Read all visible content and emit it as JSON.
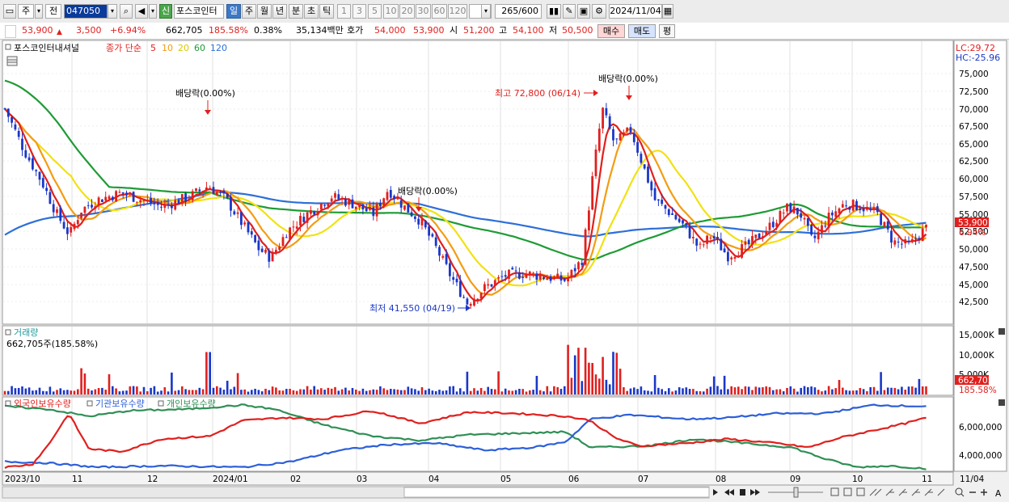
{
  "toolbar": {
    "period": "주",
    "compare": "전",
    "code": "047050",
    "credit_tag": "신",
    "stock_name": "포스코인터",
    "intervals": [
      "일",
      "주",
      "월",
      "년",
      "분",
      "초",
      "틱"
    ],
    "active_interval": "일",
    "minute_options": [
      "1",
      "3",
      "5",
      "10",
      "20",
      "30",
      "60",
      "120"
    ],
    "count": "265",
    "count_max": "/600",
    "date": "2024/11/04"
  },
  "quote": {
    "price": "53,900",
    "change": "3,500",
    "change_pct": "+6.94%",
    "volume": "662,705",
    "volume_ratio": "185.58%",
    "turnover": "0.38%",
    "amount": "35,134백만",
    "bid_label": "호가",
    "ask": "54,000",
    "bid": "53,900",
    "open_label": "시",
    "open": "51,200",
    "high_label": "고",
    "high": "54,100",
    "low_label": "저",
    "low": "50,500",
    "buy_label": "매수",
    "sell_label": "매도",
    "avg_label": "평"
  },
  "legend": {
    "name": "포스코인터내셔널",
    "series": "종가 단순",
    "ma": [
      {
        "label": "5",
        "color": "#e0201e"
      },
      {
        "label": "10",
        "color": "#f39c12"
      },
      {
        "label": "20",
        "color": "#f1e211"
      },
      {
        "label": "60",
        "color": "#1e9b35"
      },
      {
        "label": "120",
        "color": "#2d6fd8"
      }
    ]
  },
  "price_axis": {
    "lc": "LC:29.72",
    "hc": "HC:-25.96",
    "ticks": [
      "75,000",
      "72,500",
      "70,000",
      "67,500",
      "65,000",
      "62,500",
      "60,000",
      "57,500",
      "55,000",
      "52,500",
      "50,000",
      "47,500",
      "45,000",
      "42,500"
    ],
    "current": "53,900",
    "current_pct": "6.94%"
  },
  "annotations": {
    "dividend1": "배당락(0.00%)",
    "dividend2": "배당락(0.00%)",
    "dividend3": "배당락(0.00%)",
    "high": "최고 72,800 (06/14)",
    "low": "최저 41,550 (04/19)"
  },
  "volume_panel": {
    "title": "거래량",
    "value": "662,705주(185.58%)",
    "ticks": [
      "15,000K",
      "10,000K",
      "5,000K"
    ],
    "current": "662,705",
    "current_pct": "185.58%"
  },
  "holding_panel": {
    "foreign": "외국인보유수량",
    "institution": "기관보유수량",
    "individual": "개인보유수량",
    "ticks": [
      "6,000,000",
      "4,000,000"
    ],
    "colors": {
      "foreign": "#e0201e",
      "institution": "#2d5fd8",
      "individual": "#2f8f55"
    }
  },
  "x_axis": {
    "labels": [
      "2023/10",
      "11",
      "12",
      "2024/01",
      "02",
      "03",
      "04",
      "05",
      "06",
      "07",
      "08",
      "09",
      "10",
      "11"
    ],
    "right_label": "11/04"
  }
}
